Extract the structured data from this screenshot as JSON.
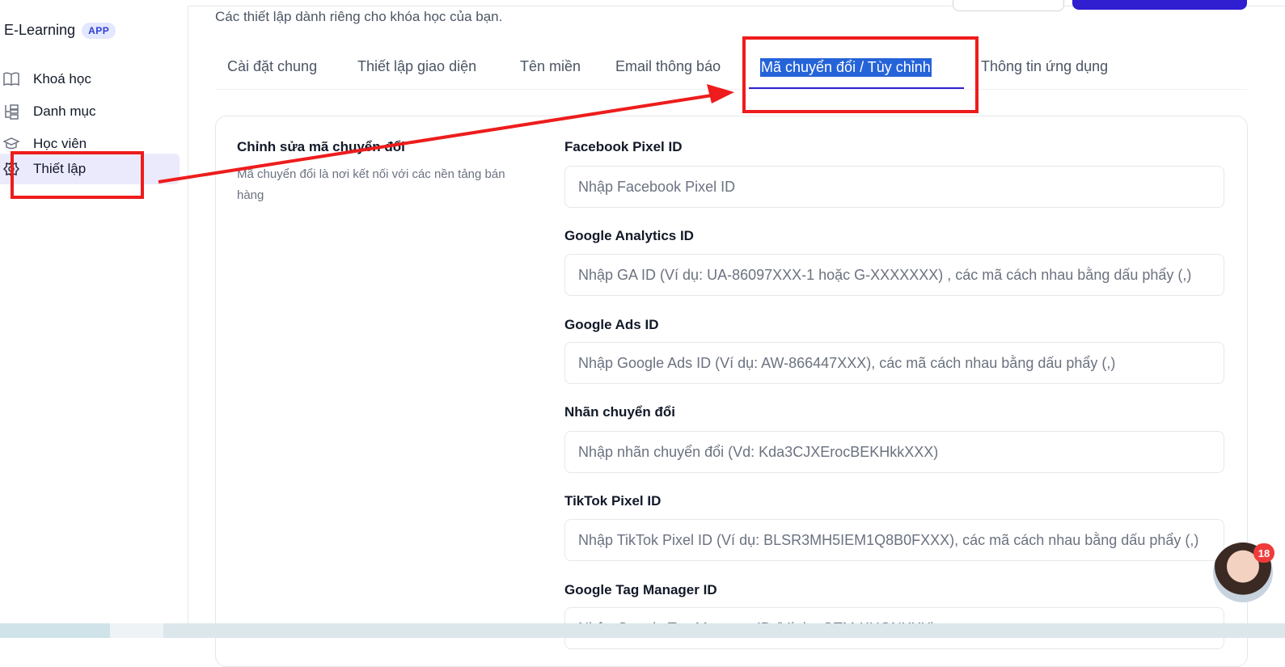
{
  "header": {
    "subtitle": "Các thiết lập dành riêng cho khóa học của bạn."
  },
  "sidebar": {
    "brand": "E-Learning",
    "badge": "APP",
    "items": [
      {
        "label": "Khoá học",
        "icon": "book-icon"
      },
      {
        "label": "Danh mục",
        "icon": "category-tree-icon"
      },
      {
        "label": "Học viên",
        "icon": "graduation-cap-icon"
      },
      {
        "label": "Thiết lập",
        "icon": "gear-icon",
        "active": true
      }
    ]
  },
  "tabs": [
    {
      "label": "Cài đặt chung"
    },
    {
      "label": "Thiết lập giao diện"
    },
    {
      "label": "Tên miền"
    },
    {
      "label": "Email thông báo"
    },
    {
      "label": "Mã chuyển đổi / Tùy chỉnh",
      "active": true
    },
    {
      "label": "Thông tin ứng dụng"
    }
  ],
  "section": {
    "title": "Chỉnh sửa mã chuyển đổi",
    "description": "Mã chuyển đổi là nơi kết nối với các nền tảng bán hàng"
  },
  "fields": [
    {
      "label": "Facebook Pixel ID",
      "placeholder": "Nhập Facebook Pixel ID"
    },
    {
      "label": "Google Analytics ID",
      "placeholder": "Nhập GA ID (Ví dụ: UA-86097XXX-1 hoặc G-XXXXXXX) , các mã cách nhau bằng dấu phẩy (,)"
    },
    {
      "label": "Google Ads ID",
      "placeholder": "Nhập Google Ads ID (Ví dụ: AW-866447XXX), các mã cách nhau bằng dấu phẩy (,)"
    },
    {
      "label": "Nhãn chuyển đổi",
      "placeholder": "Nhập nhãn chuyển đổi (Vd: Kda3CJXErocBEKHkkXXX)"
    },
    {
      "label": "TikTok Pixel ID",
      "placeholder": "Nhập TikTok Pixel ID (Ví dụ: BLSR3MH5IEM1Q8B0FXXX), các mã cách nhau bằng dấu phẩy (,)"
    },
    {
      "label": "Google Tag Manager ID",
      "placeholder": "Nhập Google Tag Manager ID (Ví dụ: GTM-KHGNXXX)"
    }
  ],
  "chat": {
    "unread_count": "18"
  },
  "colors": {
    "accent": "#2f1fd1",
    "annotation": "#ee1c1c",
    "active_tab_highlight": "#2563d8"
  }
}
